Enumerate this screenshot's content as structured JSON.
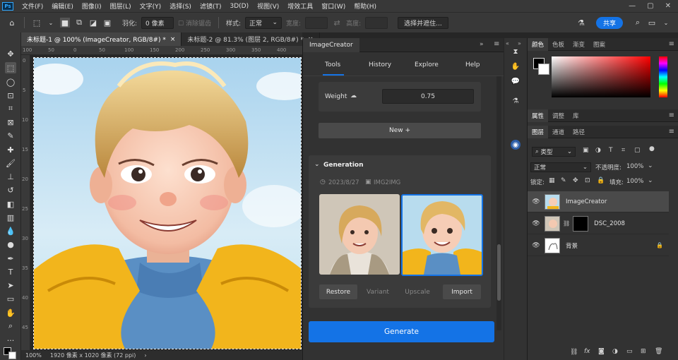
{
  "menubar": {
    "logo": "Ps",
    "items": [
      "文件(F)",
      "编辑(E)",
      "图像(I)",
      "图层(L)",
      "文字(Y)",
      "选择(S)",
      "滤镜(T)",
      "3D(D)",
      "视图(V)",
      "增效工具",
      "窗口(W)",
      "帮助(H)"
    ],
    "win": [
      "—",
      "▢",
      "✕"
    ]
  },
  "options": {
    "feather_label": "羽化:",
    "feather_value": "0 像素",
    "antialias": "消除锯齿",
    "style_label": "样式:",
    "style_value": "正常",
    "width_label": "宽度:",
    "height_label": "高度:",
    "select_mask": "选择并遮住...",
    "share": "共享"
  },
  "documents": {
    "tabs": [
      "未标题-1 @ 100% (ImageCreator, RGB/8#) *",
      "未标题-2 @ 81.3% (图层 2, RGB/8#) *"
    ],
    "ruler_h": [
      "100",
      "50",
      "0",
      "50",
      "100",
      "150",
      "200",
      "250",
      "300",
      "350",
      "400"
    ],
    "ruler_v": [
      "0",
      "5",
      "10",
      "15",
      "20",
      "25",
      "30",
      "35",
      "40",
      "45"
    ],
    "status_zoom": "100%",
    "status_info": "1920 像素 x 1020 像素 (72 ppi)"
  },
  "plugin": {
    "title": "ImageCreator",
    "nav": [
      "Tools",
      "History",
      "Explore",
      "Help"
    ],
    "weight_label": "Weight",
    "weight_value": "0.75",
    "new_button": "New +",
    "generation_title": "Generation",
    "gen_date": "2023/8/27",
    "gen_mode": "IMG2IMG",
    "actions": [
      "Restore",
      "Variant",
      "Upscale",
      "Import"
    ],
    "generate": "Generate"
  },
  "panels": {
    "color_tabs": [
      "颜色",
      "色板",
      "渐变",
      "图案"
    ],
    "props_tabs": [
      "属性",
      "调整",
      "库"
    ],
    "layer_tabs": [
      "图层",
      "通道",
      "路径"
    ],
    "kind_label": "类型",
    "blend_mode": "正常",
    "opacity_label": "不透明度:",
    "opacity_value": "100%",
    "lock_label": "锁定:",
    "fill_label": "填充:",
    "fill_value": "100%",
    "layers": [
      {
        "name": "ImageCreator"
      },
      {
        "name": "DSC_2008"
      },
      {
        "name": "背景"
      }
    ]
  },
  "colors": {
    "accent": "#1473e6"
  }
}
